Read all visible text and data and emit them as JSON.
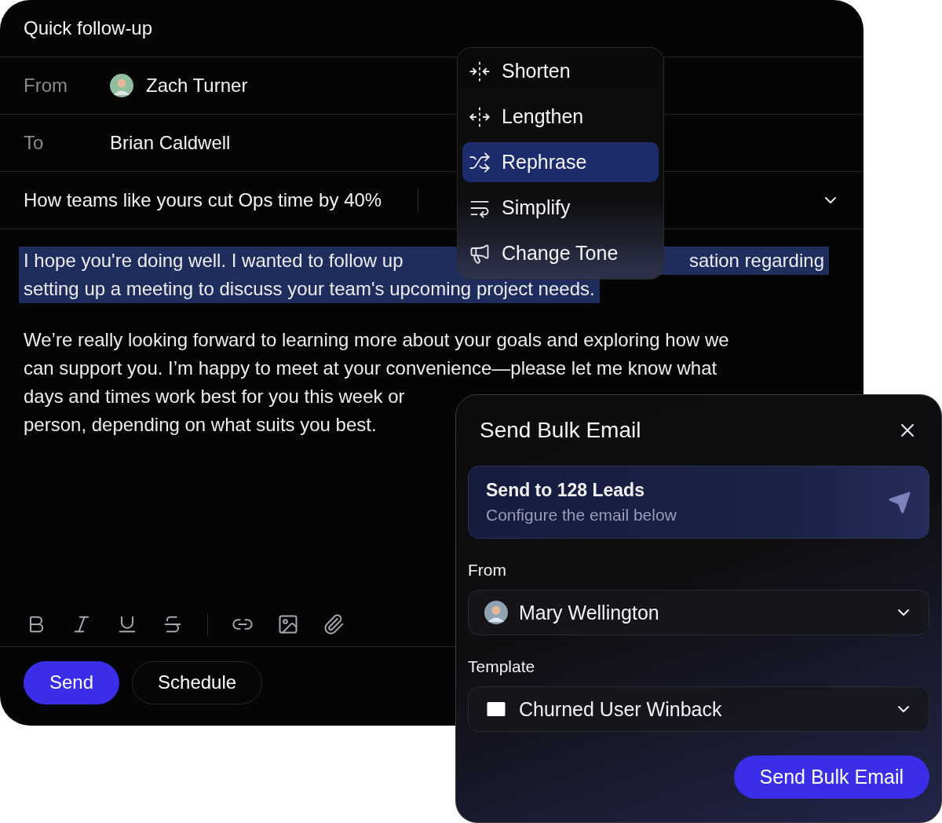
{
  "composer": {
    "title": "Quick follow-up",
    "fields": [
      {
        "label": "From",
        "value": "Zach Turner",
        "avatar": true
      },
      {
        "label": "To",
        "value": "Brian Caldwell",
        "avatar": false
      }
    ],
    "subject": "How teams like yours cut Ops time by 40%",
    "paragraphs": [
      {
        "selected": true,
        "lines": [
          [
            "I hope you're doing well. I wanted to follow up",
            "sation regarding"
          ],
          [
            "setting up a meeting to discuss your team's upcoming project needs."
          ]
        ]
      },
      {
        "selected": false,
        "lines": [
          [
            "We’re really looking forward to learning more about your goals and exploring how we"
          ],
          [
            "can support you. I’m happy to meet at your convenience—please let me know what"
          ],
          [
            "days and times work best for you this week or"
          ],
          [
            "person, depending on what suits you best."
          ]
        ]
      }
    ],
    "buttons": [
      {
        "label": "Send",
        "kind": "primary"
      },
      {
        "label": "Schedule",
        "kind": "secondary"
      }
    ]
  },
  "rewrite_menu": {
    "items": [
      {
        "label": "Shorten",
        "selected": false
      },
      {
        "label": "Lengthen",
        "selected": false
      },
      {
        "label": "Rephrase",
        "selected": true
      },
      {
        "label": "Simplify",
        "selected": false
      },
      {
        "label": "Change Tone",
        "selected": false
      }
    ]
  },
  "bulk_email": {
    "title": "Send Bulk Email",
    "summary": {
      "title": "Send to 128 Leads",
      "subtitle": "Configure the email below"
    },
    "fields": [
      {
        "label": "From",
        "value": "Mary Wellington",
        "kind": "person"
      },
      {
        "label": "Template",
        "value": "Churned User Winback",
        "kind": "template"
      }
    ],
    "button": "Send Bulk Email"
  }
}
